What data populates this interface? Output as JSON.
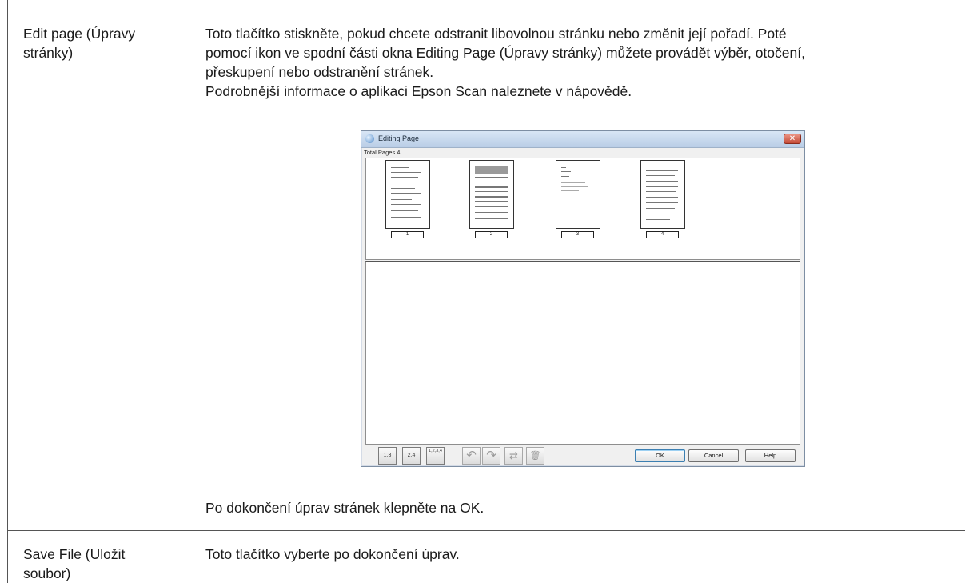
{
  "table": {
    "rows": [
      {
        "term": [
          "Edit page (Úpravy",
          "stránky)"
        ],
        "desc": [
          "Toto tlačítko stiskněte, pokud chcete odstranit libovolnou stránku nebo změnit její pořadí. Poté",
          "pomocí ikon ve spodní části okna Editing Page (Úpravy stránky) můžete provádět výběr, otočení,",
          "přeskupení nebo odstranění stránek.",
          "Podrobnější informace o aplikaci Epson Scan naleznete v nápovědě."
        ],
        "after": "Po dokončení úprav stránek klepněte na OK."
      },
      {
        "term": [
          "Save File (Uložit",
          "soubor)"
        ],
        "desc": [
          "Toto tlačítko vyberte po dokončení úprav."
        ]
      }
    ]
  },
  "dialog": {
    "title": "Editing Page",
    "close_glyph": "✕",
    "total_pages": "Total Pages 4",
    "pages": [
      "1",
      "2",
      "3",
      "4"
    ],
    "tools": {
      "odd_pages": "1,3",
      "even_pages": "2,4",
      "all_pages": "1,2,3,4",
      "rotate_left": "↶",
      "rotate_right": "↷",
      "reorder": "⇄",
      "delete": "🗑"
    },
    "buttons": {
      "ok": "OK",
      "cancel": "Cancel",
      "help": "Help"
    }
  }
}
